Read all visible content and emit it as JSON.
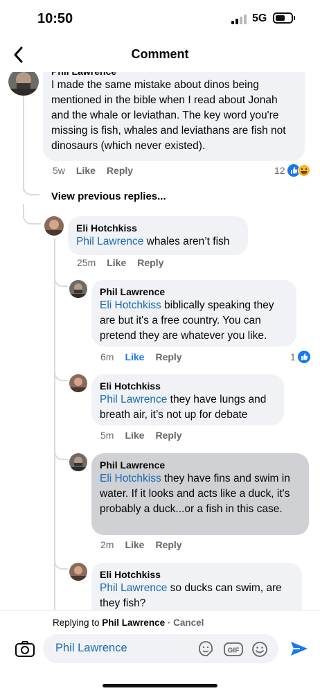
{
  "status_bar": {
    "time": "10:50",
    "network": "5G",
    "battery_level": 0.45
  },
  "header": {
    "title": "Comment"
  },
  "parent_comment": {
    "author": "Phil Lawrence",
    "text": "I made the same mistake about dinos being mentioned in the bible when I read about Jonah and the whale or leviathan. The key word you're missing is fish, whales and leviathans are fish not dinosaurs (which never existed).",
    "time": "5w",
    "like_label": "Like",
    "reply_label": "Reply",
    "reaction_count": "12"
  },
  "view_previous_label": "View previous replies...",
  "replies": [
    {
      "author": "Eli Hotchkiss",
      "mention": "Phil Lawrence",
      "text": " whales aren’t fish",
      "time": "25m",
      "like_label": "Like",
      "reply_label": "Reply"
    },
    {
      "author": "Phil Lawrence",
      "mention": "Eli Hotchkiss",
      "text": " biblically speaking they are but it's a free country. You can pretend they are whatever you like.",
      "time": "6m",
      "like_label": "Like",
      "reply_label": "Reply",
      "reaction_count": "1"
    },
    {
      "author": "Eli Hotchkiss",
      "mention": "Phil Lawrence",
      "text": " they have lungs and breath air, it’s not up for debate",
      "time": "5m",
      "like_label": "Like",
      "reply_label": "Reply"
    },
    {
      "author": "Phil Lawrence",
      "mention": "Eli Hotchkiss",
      "text": " they have fins and swim in water. If it looks and acts like a duck, it's probably a duck...or a fish in this case.",
      "time": "2m",
      "like_label": "Like",
      "reply_label": "Reply"
    },
    {
      "author": "Eli Hotchkiss",
      "mention": "Phil Lawrence",
      "text": " so ducks can swim, are they fish?"
    }
  ],
  "reply_bar": {
    "replying_prefix": "Replying to ",
    "replying_to": "Phil Lawrence",
    "separator": " · ",
    "cancel_label": "Cancel",
    "input_value": "Phil Lawrence",
    "gif_label": "GIF"
  },
  "colors": {
    "mention": "#1a6ab2",
    "like_active": "#1877f2",
    "send": "#1877f2",
    "bubble": "#f0f2f5",
    "bubble_pressed": "#cfd1d5"
  },
  "icons": [
    "back-chevron-icon",
    "camera-icon",
    "sticker-icon",
    "gif-icon",
    "emoji-icon",
    "send-icon",
    "like-reaction-icon",
    "haha-reaction-icon"
  ]
}
